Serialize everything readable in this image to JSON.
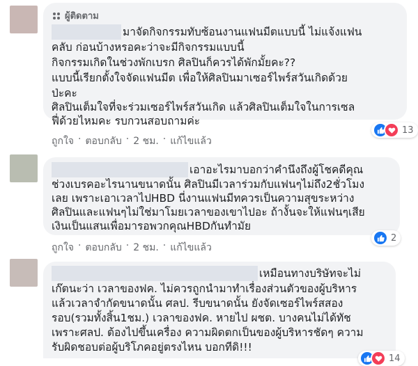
{
  "comments": [
    {
      "badge": "ผู้ติดตาม",
      "lines": [
        "มาจัดกิจกรรมทับซ้อนงานแฟนมีตแบบนี้ ไม่แจ้งแฟน",
        "คลับ ก่อนบ้างหรอคะว่าจะมีกิจกรรมแบบนี้",
        "กิจกรรมเกิดในช่วงพักเบรก ศิลปินก็ควรได้พักมั้ยคะ??",
        "แบบนี้เรียกตั้งใจจัดแฟนมีต เพื่อให้ศิลปินมาเซอร์ไพร์สวันเกิดด้วย",
        "ป่ะคะ",
        "ศิลปินเต็มใจที่จะร่วมเซอร์ไพร์สวันเกิด แล้วศิลปินเต็มใจในการเซล",
        "ฟี่ด้วยไหมคะ รบกวนสอบถามค่ะ"
      ],
      "actions": {
        "like": "ถูกใจ",
        "reply": "ตอบกลับ",
        "time": "2 ชม.",
        "edited": "แก้ไขแล้ว"
      },
      "reaction_count": "13",
      "reactions": [
        "like-icon",
        "love-icon"
      ]
    },
    {
      "lines": [
        "เอาอะไรมาบอกว่าคำนึงถึงผู้โชคดีคุณ",
        "ช่วงเบรคอะไรนานขนาดนั้น ศิลปินมีเวลาร่วมกับแฟนๆไม่ถึง2ชั่วโมง",
        "เลย เพราะเอาเวลาไปHBD นี่งานแฟนมีทควรเป็นความสุขระหว่าง",
        "ศิลปินและแฟนๆไม่ใช่มาโมยเวลาของเขาไปอะ ถ้างั้นจะให้แฟนๆเสีย",
        "เงินเป็นแสนเพื่อมารอพวกคุณHBDกันทำมัย"
      ],
      "actions": {
        "like": "ถูกใจ",
        "reply": "ตอบกลับ",
        "time": "2 ชม.",
        "edited": "แก้ไขแล้ว"
      },
      "reaction_count": "2",
      "reactions": [
        "like-icon"
      ]
    },
    {
      "lines": [
        "เหมือนทางบริษัทจะไม่",
        "เก๊ตนะว่า เวลาของฟค. ไม่ควรถูกนำมาทำเรื่องส่วนตัวของผู้บริหาร",
        "แล้วเวลาจำกัดขนาดนั้น ศลป. รีบขนาดนั้น ยังจัดเซอร์ไพร์สสอง",
        "รอบ(รวมทั้งสิ้น1ชม.) เวลาของฟค. หายไป ผชต. บางคนไม่ได้ทัช",
        "เพราะศลป. ต้องไปขึ้นเครื่อง ความผิดตกเป็นของผู้บริหารชัดๆ ความ",
        "รับผิดชอบต่อผู้บริโภคอยู่ตรงไหน บอกทีดิ!!!"
      ],
      "reaction_count": "14",
      "reactions": [
        "like-icon",
        "love-icon"
      ]
    }
  ],
  "colors": {
    "bubble": "#f2f3f5",
    "like": "#1877f2",
    "love": "#f33e58",
    "secondary_text": "#65676b",
    "avatar1": "#c9b7b4",
    "avatar2": "#b9bdb1",
    "avatar3": "#c7bcb8"
  }
}
